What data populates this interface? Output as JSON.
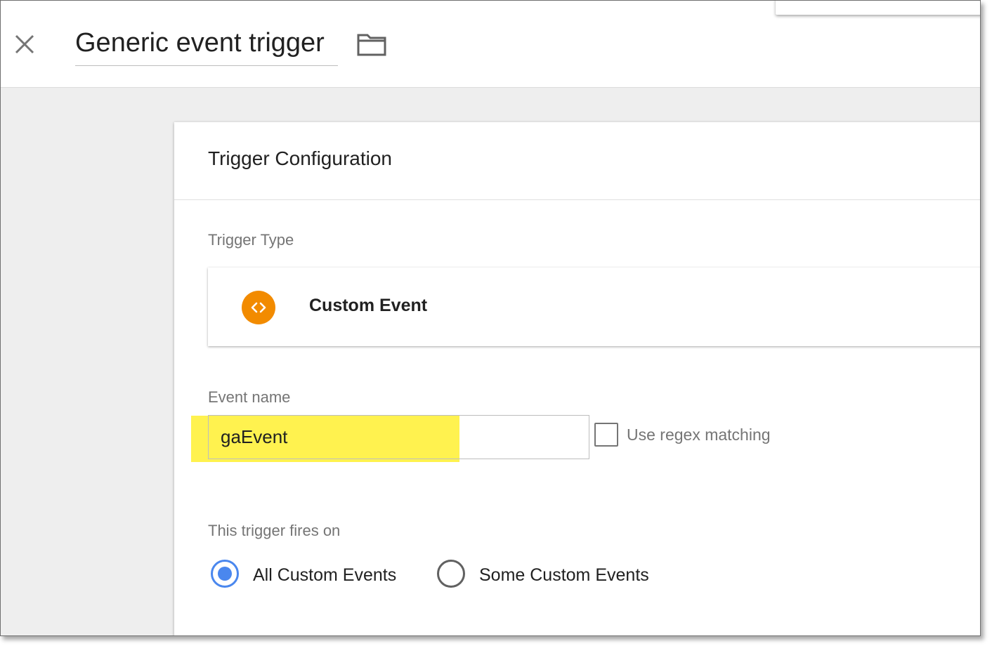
{
  "header": {
    "title": "Generic event trigger",
    "close_icon": "close-icon",
    "folder_icon": "folder-icon"
  },
  "card": {
    "title": "Trigger Configuration",
    "trigger_type": {
      "label": "Trigger Type",
      "name": "Custom Event",
      "icon": "code-brackets-icon",
      "icon_color": "#f28b00"
    },
    "event_name": {
      "label": "Event name",
      "value": "gaEvent",
      "highlight_color": "#fff24f"
    },
    "regex": {
      "label": "Use regex matching",
      "checked": false
    },
    "fires_on": {
      "label": "This trigger fires on",
      "options": [
        {
          "label": "All Custom Events",
          "selected": true
        },
        {
          "label": "Some Custom Events",
          "selected": false
        }
      ],
      "accent_color": "#4a87ee"
    }
  }
}
